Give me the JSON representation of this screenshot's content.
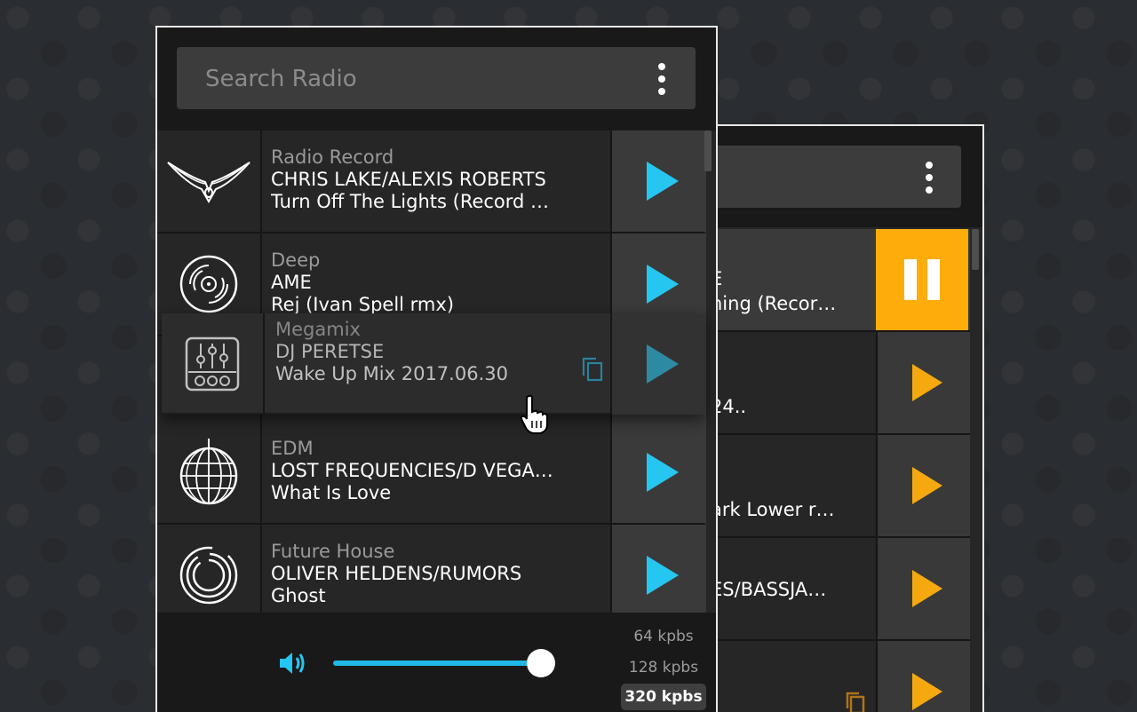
{
  "colors": {
    "accent": "#25c6ef",
    "play_back": "#f5a90f",
    "active_back": "#fdac0a"
  },
  "front": {
    "search_placeholder": "Search Radio",
    "menu_icon": "kebab-menu-icon",
    "stations": [
      {
        "icon": "wings-logo-icon",
        "genre": "Radio Record",
        "artist": "CHRIS LAKE/ALEXIS ROBERTS",
        "song": "Turn Off The Lights (Record …"
      },
      {
        "icon": "vinyl-record-icon",
        "genre": "Deep",
        "artist": "AME",
        "song": "Rej (Ivan Spell rmx)"
      },
      {
        "icon": "disco-ball-icon",
        "genre": "EDM",
        "artist": "LOST FREQUENCIES/D VEGA…",
        "song": "What Is Love"
      },
      {
        "icon": "circular-lines-icon",
        "genre": "Future House",
        "artist": "OLIVER HELDENS/RUMORS",
        "song": "Ghost"
      }
    ],
    "dragged": {
      "icon": "mixer-icon",
      "genre": "Megamix",
      "artist": "DJ PERETSE",
      "song": "Wake Up Mix 2017.06.30"
    },
    "volume_level": 0.98,
    "bitrates": [
      "64 kpbs",
      "128 kpbs",
      "320 kpbs"
    ],
    "selected_bitrate": "320 kpbs"
  },
  "back": {
    "rows": [
      {
        "line1": "E",
        "line2": "ning (Recor…",
        "state": "playing"
      },
      {
        "line1": "",
        "line2": "24..",
        "state": "idle"
      },
      {
        "line1": "",
        "line2": "ark Lower r…",
        "state": "idle"
      },
      {
        "line1": "ES/BASSJA…",
        "line2": "",
        "state": "idle"
      },
      {
        "line1": "",
        "line2": "",
        "state": "idle"
      }
    ]
  }
}
